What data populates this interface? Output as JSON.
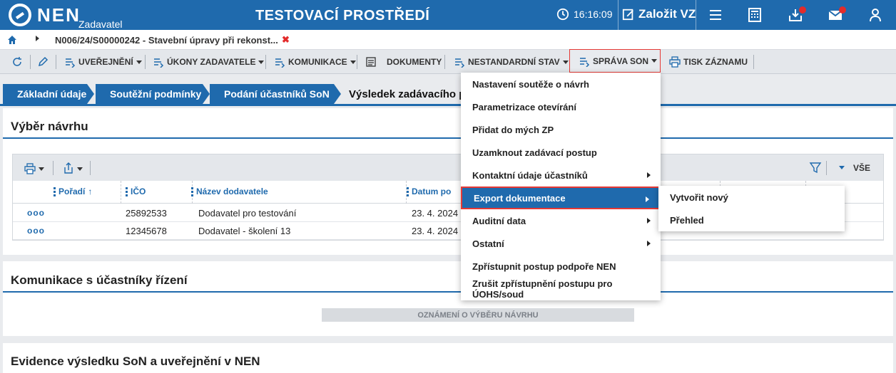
{
  "header": {
    "brand": "NEN",
    "brand_sub": "Zadavatel",
    "environment": "TESTOVACÍ PROSTŘEDÍ",
    "clock": "16:16:09",
    "create_label": "Založit VZ"
  },
  "breadcrumb": {
    "text": "N006/24/S00000242 - Stavební úpravy při rekonst...",
    "close_glyph": "✖"
  },
  "toolbar": {
    "publish": "UVEŘEJNĚNÍ",
    "actions": "ÚKONY ZADAVATELE",
    "communication": "KOMUNIKACE",
    "documents": "DOKUMENTY",
    "nonstandard": "NESTANDARDNÍ STAV",
    "manage": "SPRÁVA SON",
    "print": "TISK ZÁZNAMU"
  },
  "tabs": [
    {
      "label": "Základní údaje"
    },
    {
      "label": "Soutěžní podmínky"
    },
    {
      "label": "Podání účastníků SoN"
    },
    {
      "label": "Výsledek zadávacího po"
    }
  ],
  "section_selection": {
    "title": "Výběr návrhu",
    "filter_all": "VŠE",
    "columns": [
      "Pořadí",
      "IČO",
      "Název dodavatele",
      "Datum po"
    ],
    "rows": [
      {
        "actions": "ooo",
        "ico": "25892533",
        "name": "Dodavatel pro testování",
        "date": "23. 4. 2024"
      },
      {
        "actions": "ooo",
        "ico": "12345678",
        "name": "Dodavatel - školení 13",
        "date": "23. 4. 2024"
      }
    ]
  },
  "section_communication": {
    "title": "Komunikace s účastníky řízení",
    "notice_label": "OZNÁMENÍ O VÝBĚRU NÁVRHU"
  },
  "section_evidence": {
    "title": "Evidence výsledku SoN a uveřejnění v NEN"
  },
  "menu": {
    "items": [
      {
        "label": "Nastavení soutěže o návrh"
      },
      {
        "label": "Parametrizace otevírání"
      },
      {
        "label": "Přidat do mých ZP"
      },
      {
        "label": "Uzamknout zadávací postup"
      },
      {
        "label": "Kontaktní údaje účastníků"
      },
      {
        "label": "Export dokumentace"
      },
      {
        "label": "Auditní data"
      },
      {
        "label": "Ostatní"
      },
      {
        "label": "Zpřístupnit postup podpoře NEN"
      },
      {
        "label": "Zrušit zpřístupnění postupu pro ÚOHS/soud"
      }
    ],
    "submenu": [
      {
        "label": "Vytvořit nový"
      },
      {
        "label": "Přehled"
      }
    ]
  },
  "colors": {
    "primary": "#1f6aad",
    "highlight_border": "#e53935",
    "notification_dot": "#e32b2b"
  }
}
